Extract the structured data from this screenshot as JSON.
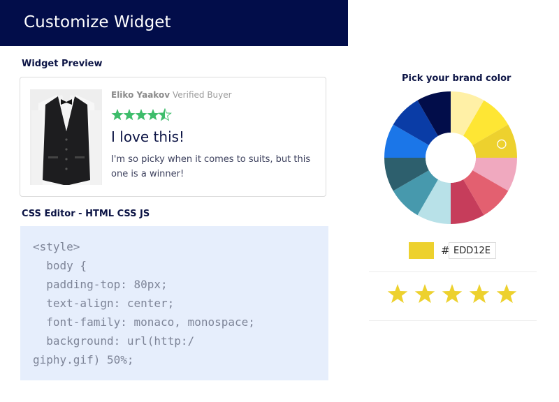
{
  "header": {
    "title": "Customize Widget"
  },
  "preview": {
    "label": "Widget Preview",
    "review": {
      "reviewer": "Eliko Yaakov",
      "badge": "Verified Buyer",
      "rating": 4.5,
      "rating_max": 5,
      "title": "I love this!",
      "body": "I'm so picky when it comes to suits, but this one is a winner!"
    }
  },
  "editor": {
    "label": "CSS Editor - HTML CSS JS",
    "code_lines": [
      "<style>",
      "  body {",
      "  padding-top: 80px;",
      "  text-align: center;",
      "  font-family: monaco, monospace;",
      "  background: url(http:/",
      "giphy.gif) 50%;"
    ]
  },
  "color_picker": {
    "label": "Pick your brand color",
    "hash": "#",
    "hex_value": "EDD12E",
    "wheel_colors": [
      "#fff0a6",
      "#fee634",
      "#edd12e",
      "#f0a9bf",
      "#e36070",
      "#c63d5b",
      "#b8e1e8",
      "#4799ad",
      "#2d5f6d",
      "#1b76e8",
      "#0a3ca6",
      "#020d4a"
    ],
    "selected_color": "#edd12e"
  },
  "star_picker": {
    "count": 5,
    "color": "#edd12e"
  },
  "colors": {
    "header_bg": "#020d4a",
    "review_star": "#3ebd6b",
    "code_bg": "#e6eefc"
  }
}
